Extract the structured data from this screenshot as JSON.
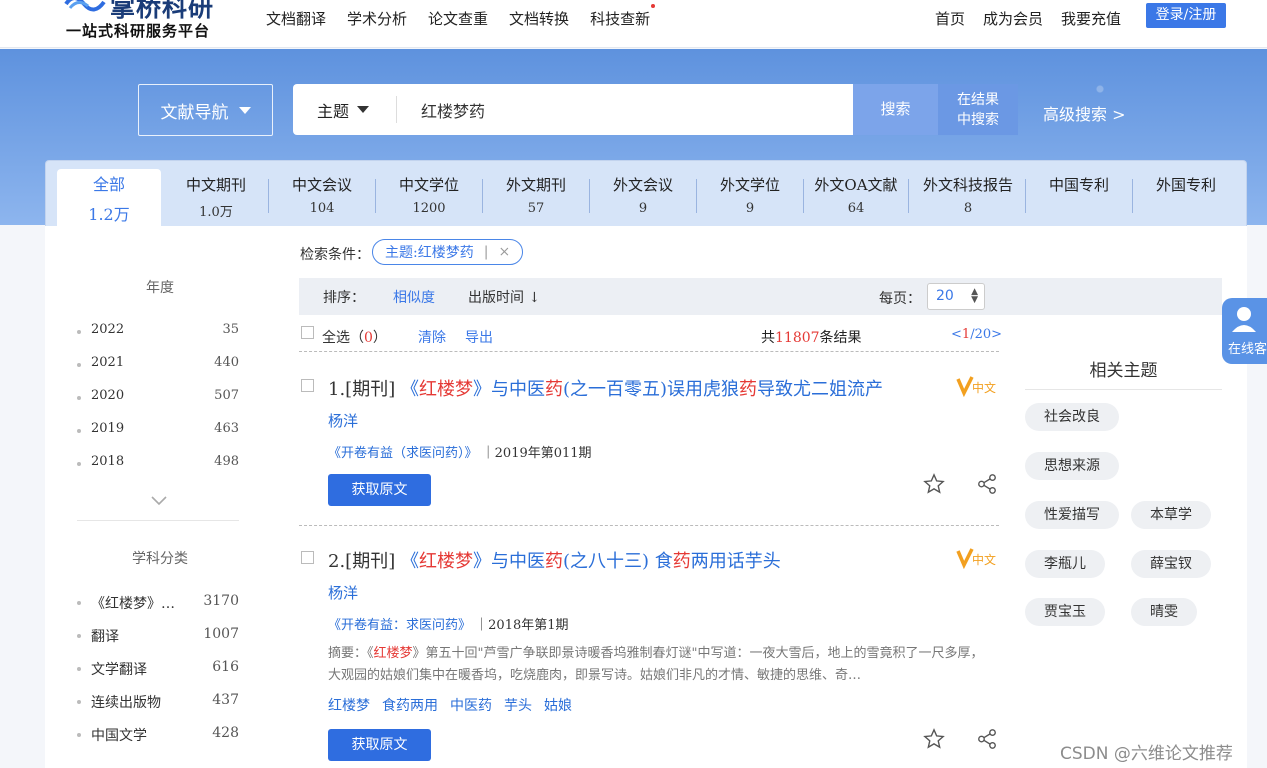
{
  "brand": {
    "title": "掌桥科研",
    "subtitle": "一站式科研服务平台"
  },
  "nav": {
    "main": [
      "文档翻译",
      "学术分析",
      "论文查重",
      "文档转换",
      "科技查新"
    ],
    "right": [
      "首页",
      "成为会员",
      "我要充值"
    ],
    "login": "登录/注册"
  },
  "search": {
    "nav_select": "文献导航",
    "field": "主题",
    "query": "红楼梦药",
    "search_btn": "搜索",
    "refine_btn_1": "在结果",
    "refine_btn_2": "中搜索",
    "advanced": "高级搜索 >"
  },
  "tabs": [
    {
      "label": "全部",
      "count": "1.2万"
    },
    {
      "label": "中文期刊",
      "count": "1.0万"
    },
    {
      "label": "中文会议",
      "count": "104"
    },
    {
      "label": "中文学位",
      "count": "1200"
    },
    {
      "label": "外文期刊",
      "count": "57"
    },
    {
      "label": "外文会议",
      "count": "9"
    },
    {
      "label": "外文学位",
      "count": "9"
    },
    {
      "label": "外文OA文献",
      "count": "64"
    },
    {
      "label": "外文科技报告",
      "count": "8"
    },
    {
      "label": "中国专利",
      "count": ""
    },
    {
      "label": "外国专利",
      "count": ""
    }
  ],
  "sidebar": {
    "year_title": "年度",
    "years": [
      {
        "label": "2022",
        "count": "35"
      },
      {
        "label": "2021",
        "count": "440"
      },
      {
        "label": "2020",
        "count": "507"
      },
      {
        "label": "2019",
        "count": "463"
      },
      {
        "label": "2018",
        "count": "498"
      }
    ],
    "subject_title": "学科分类",
    "subjects": [
      {
        "label": "《红楼梦》…",
        "count": "3170"
      },
      {
        "label": "翻译",
        "count": "1007"
      },
      {
        "label": "文学翻译",
        "count": "616"
      },
      {
        "label": "连续出版物",
        "count": "437"
      },
      {
        "label": "中国文学",
        "count": "428"
      }
    ]
  },
  "conditions": {
    "label": "检索条件：",
    "chip": "主题:红楼梦药",
    "chip_sep": "|",
    "remove": "×"
  },
  "sortbar": {
    "label": "排序：",
    "relevance": "相似度",
    "pubtime": "出版时间 ↓",
    "per_page_label": "每页：",
    "per_page": "20",
    "per_page_arrows": "▲▼"
  },
  "listhead": {
    "select_all": "全选",
    "selected_count": "0",
    "clear": "清除",
    "export": "导出",
    "total_prefix": "共",
    "total": "11807",
    "total_suffix": "条结果",
    "page_current": "1",
    "page_total": "20"
  },
  "results": [
    {
      "prefix": "1.[期刊]",
      "t1": "《",
      "t2": "红楼梦",
      "t3": "》与中医",
      "t4": "药",
      "t5": "(之一百零五)误用虎狼",
      "t6": "药",
      "t7": "导致尤二姐流产",
      "author": "杨洋",
      "journal": "《开卷有益（求医问药）》",
      "issue": "｜2019年第011期",
      "abstract": "",
      "keywords": [],
      "button": "获取原文"
    },
    {
      "prefix": "2.[期刊]",
      "t1": "《",
      "t2": "红楼梦",
      "t3": "》与中医",
      "t4": "药",
      "t5": "(之八十三) 食",
      "t6": "药",
      "t7": "两用话芋头",
      "author": "杨洋",
      "journal": "《开卷有益：求医问药》",
      "issue": "｜2018年第1期",
      "abstract_pre": "摘要：《",
      "abstract_hl": "红楼梦",
      "abstract_post": "》第五十回\"芦雪广争联即景诗暖香坞雅制春灯谜\"中写道：一夜大雪后，地上的雪竟积了一尺多厚，大观园的姑娘们集中在暖香坞，吃烧鹿肉，即景写诗。姑娘们非凡的才情、敏捷的思维、奇…",
      "keywords": [
        "红楼梦",
        "食药两用",
        "中医药",
        "芋头",
        "姑娘"
      ],
      "button": "获取原文"
    }
  ],
  "related": {
    "title": "相关主题",
    "topics": [
      "社会改良",
      "思想来源",
      "性爱描写",
      "本草学",
      "李瓶儿",
      "薛宝钗",
      "贾宝玉",
      "晴雯"
    ]
  },
  "service": {
    "label": "在线客"
  },
  "watermark": "CSDN @六维论文推荐",
  "colors": {
    "primary": "#3b78e7",
    "highlight": "#e53935",
    "hero": "#6b98e4"
  }
}
